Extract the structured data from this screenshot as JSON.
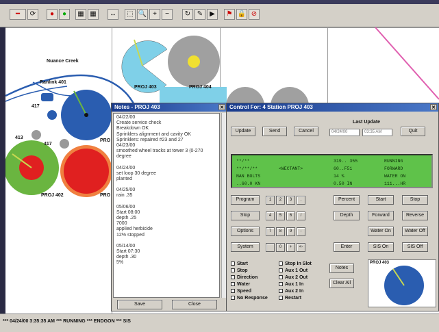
{
  "map": {
    "labels": {
      "canal": "Nuance Creek",
      "lateral": "Ranlink 401",
      "n417a": "417",
      "n417b": "417",
      "n413": "413",
      "proj_a": "PROJ 402",
      "proj_b": "PROJ 403",
      "proj_c": "PROJ 404",
      "proj_d": "PRO",
      "proj_e": "PRO"
    }
  },
  "notes_window": {
    "title": "Notes - PROJ 403",
    "lines": [
      "04/22/00",
      "Create service check",
      "Breakdown OK",
      "Sprinklers alignment and cavity OK",
      "Sprinklers: repaired #23 and 27",
      "04/23/00",
      "smoothed wheel tracks at tower 3 (0-270",
      "degree",
      "",
      "04/24/00",
      "set loop 30 degree",
      "planted",
      "",
      "04/25/00",
      "rain .35",
      "",
      "05/06/00",
      "Start 08:00",
      "depth .25",
      "7000",
      "applied herbicide",
      "12% stopped",
      "",
      "05/14/00",
      "Start 07:30",
      "depth .30",
      "5%"
    ],
    "save_label": "Save",
    "close_label": "Close"
  },
  "control_window": {
    "title": "Control For: 4 Station PROJ 403",
    "buttons": {
      "update": "Update",
      "send": "Send",
      "cancel": "Cancel",
      "quit": "Quit"
    },
    "last_update_label": "Last Update",
    "last_update_date": "04/24/00",
    "last_update_time": "03:35 AM",
    "lcd_rows": [
      [
        "**/**",
        "",
        "319.. 355",
        "RUNNING"
      ],
      [
        "**/**/**",
        "<WECTANT>",
        "60..F51",
        "FORWARD"
      ],
      [
        "NAN BOLTS",
        "",
        "14 %",
        "WATER ON"
      ],
      [
        "..60.0 KN",
        "",
        "0.50 IN",
        "111...HR"
      ]
    ],
    "left_buttons": [
      "Program",
      "Stop",
      "Options",
      "System"
    ],
    "keypad": [
      [
        "1",
        "2",
        "3",
        "."
      ],
      [
        "4",
        "5",
        "6",
        "/"
      ],
      [
        "7",
        "8",
        "9",
        "-"
      ],
      [
        "",
        "0",
        "+",
        "<-"
      ]
    ],
    "right_buttons": [
      [
        "Percent",
        "Start",
        "Stop"
      ],
      [
        "Depth",
        "Forward",
        "Reverse"
      ],
      [
        "",
        "Water On",
        "Water Off"
      ],
      [
        "Enter",
        "SIS On",
        "SIS Off"
      ]
    ],
    "alarms_col1": [
      "Start",
      "Stop",
      "Direction",
      "Water",
      "Speed",
      "No Response"
    ],
    "alarms_col2": [
      "Stop In Slot",
      "Aux 1 Out",
      "Aux 2 Out",
      "Aux 1 In",
      "Aux 2 In",
      "Restart"
    ],
    "notes_button": "Notes",
    "clear_all_button": "Clear All",
    "thumb_label": "PROJ 403"
  },
  "status_bar": {
    "text": "*** 04/24/00 3:35:35 AM *** RUNNING *** ENDGON *** SIS"
  },
  "colors": {
    "accent_blue": "#2a5db0",
    "lcd_green": "#5fc24a",
    "alert_red": "#e02020",
    "field_green": "#6ab540"
  }
}
